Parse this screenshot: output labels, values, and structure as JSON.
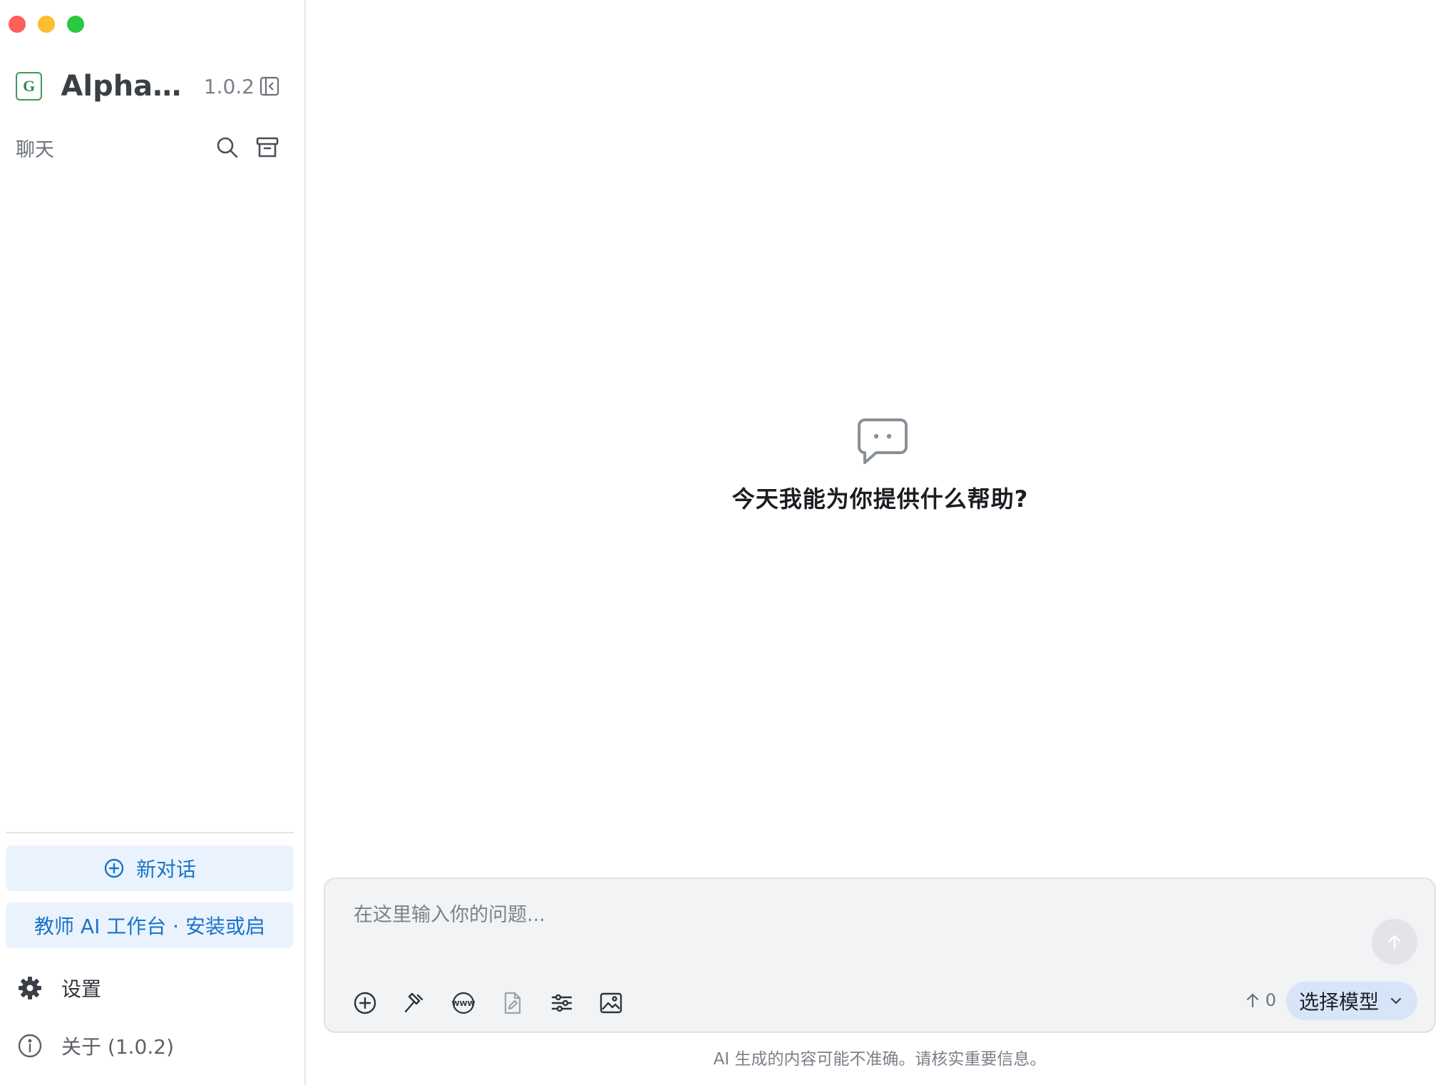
{
  "window": {
    "controls": [
      "close",
      "minimize",
      "zoom"
    ]
  },
  "sidebar": {
    "app_name": "AlphaT...",
    "version": "1.0.2",
    "logo_letter": "G",
    "section_title": "聊天",
    "icons": {
      "collapse": "sidebar-collapse-icon",
      "search": "search-icon",
      "archive": "archive-icon"
    },
    "new_chat_label": "新对话",
    "promo_label": "教师 AI 工作台 · 安装或启",
    "settings_label": "设置",
    "about_label": "关于 (1.0.2)"
  },
  "main": {
    "greeting": "今天我能为你提供什么帮助?",
    "input_placeholder": "在这里输入你的问题...",
    "token_count": "0",
    "model_select_label": "选择模型",
    "tools": [
      "plus-circle-icon",
      "hammer-icon",
      "www-icon",
      "document-edit-icon",
      "sliders-icon",
      "image-icon"
    ],
    "disclaimer": "AI 生成的内容可能不准确。请核实重要信息。"
  },
  "colors": {
    "accent": "#1a73c8",
    "accent_bg": "#eaf3fd",
    "model_pill_bg": "#d8e4f8",
    "composer_bg": "#f1f3f5"
  }
}
